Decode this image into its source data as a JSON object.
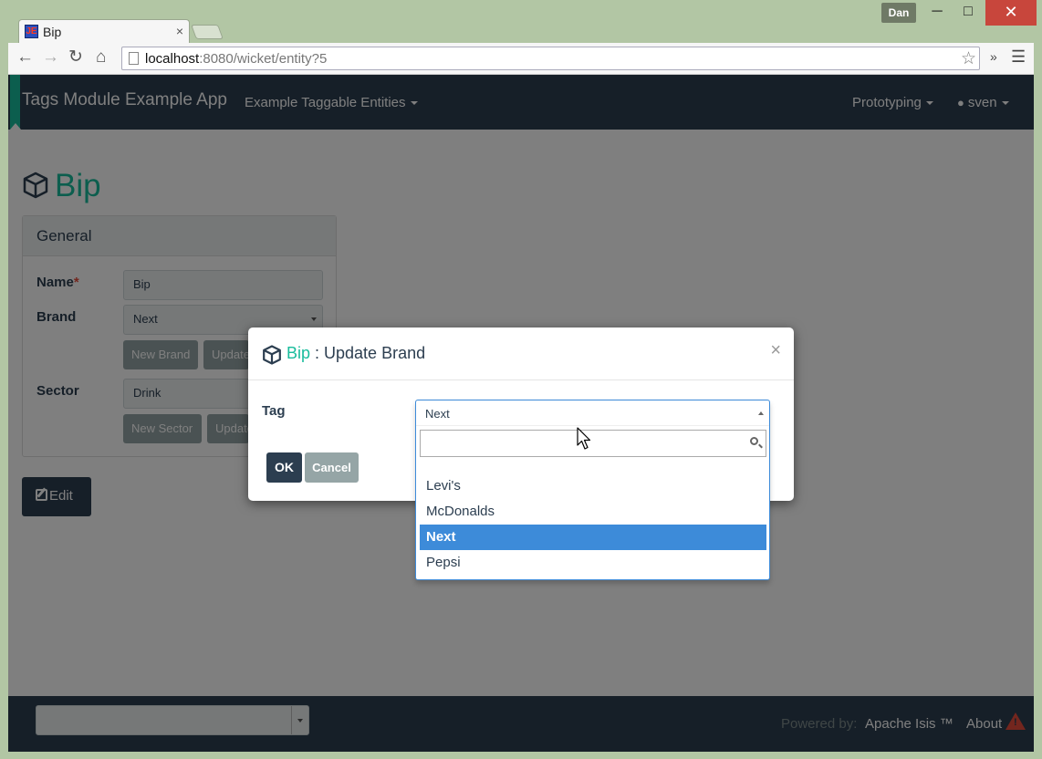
{
  "browser": {
    "tab_title": "Bip",
    "tab_favicon": "JE",
    "user_badge": "Dan",
    "url_host": "localhost",
    "url_rest": ":8080/wicket/entity?5",
    "close_glyph": "×"
  },
  "navbar": {
    "brand": "Tags Module Example App",
    "menu_entities": "Example Taggable Entities",
    "menu_prototyping": "Prototyping",
    "menu_user": "sven"
  },
  "entity": {
    "title": "Bip",
    "panel_title": "General",
    "fields": {
      "name_label": "Name",
      "name_required": "*",
      "name_value": "Bip",
      "brand_label": "Brand",
      "brand_value": "Next",
      "sector_label": "Sector",
      "sector_value": "Drink"
    },
    "buttons": {
      "new_brand": "New Brand",
      "update_brand": "Update",
      "new_sector": "New Sector",
      "update_sector": "Update",
      "edit": "Edit"
    }
  },
  "modal": {
    "title_entity": "Bip",
    "title_action": " : Update Brand",
    "close": "×",
    "field_label": "Tag",
    "ok": "OK",
    "cancel": "Cancel"
  },
  "dropdown": {
    "current": "Next",
    "search_value": "",
    "options": [
      "Levi's",
      "McDonalds",
      "Next",
      "Pepsi"
    ],
    "selected_index": 2
  },
  "footer": {
    "powered_by": "Powered by:",
    "isis": "Apache Isis ™",
    "about": "About"
  },
  "colors": {
    "navbar": "#2c3e50",
    "accent": "#18bc9c",
    "selection": "#3d8bd9",
    "secondary_button": "#95a5a6"
  },
  "icons": [
    "cube-icon",
    "user-icon",
    "edit-icon",
    "search-icon",
    "warning-icon",
    "star-icon",
    "back-icon",
    "forward-icon",
    "reload-icon",
    "home-icon",
    "menu-icon"
  ]
}
